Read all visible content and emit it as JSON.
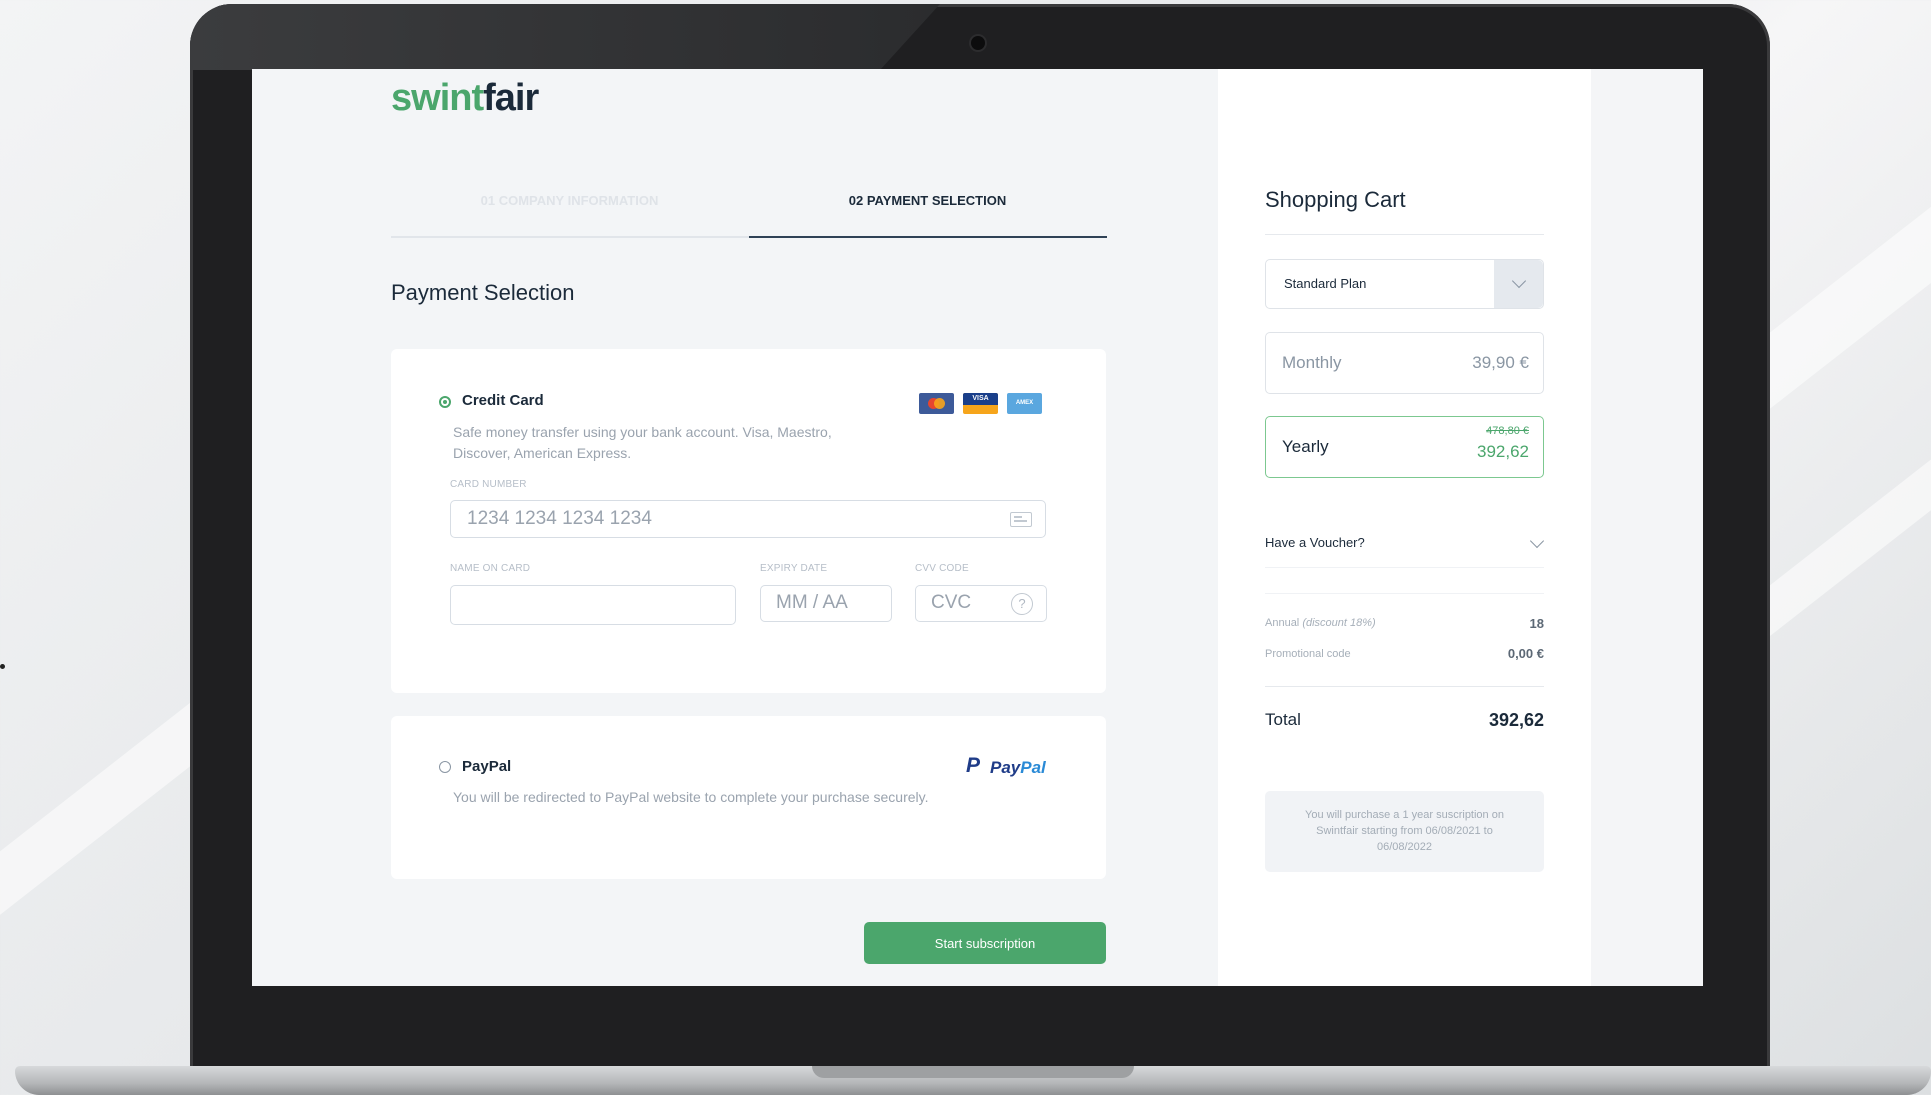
{
  "logo": {
    "part1": "swint",
    "part2": "fair"
  },
  "steps": [
    {
      "label": "01 COMPANY INFORMATION"
    },
    {
      "label": "02 PAYMENT SELECTION"
    }
  ],
  "payment": {
    "title": "Payment Selection",
    "credit_card": {
      "title": "Credit Card",
      "description": "Safe money transfer using your bank account. Visa, Maestro, Discover, American Express.",
      "brands": [
        "mastercard-icon",
        "visa-icon",
        "amex-icon"
      ],
      "visa_text": "VISA",
      "amex_text": "AMEX",
      "card_number_label": "CARD NUMBER",
      "card_number_placeholder": "1234 1234 1234 1234",
      "name_label": "NAME ON CARD",
      "name_value": "",
      "expiry_label": "EXPIRY DATE",
      "expiry_placeholder": "MM / AA",
      "cvv_label": "CVV CODE",
      "cvv_placeholder": "CVC",
      "help_glyph": "?"
    },
    "paypal": {
      "title": "PayPal",
      "description": "You will be redirected to PayPal website to complete your purchase securely.",
      "logo_p": "P",
      "logo_text1": "Pay",
      "logo_text2": "Pal"
    },
    "submit_label": "Start subscription"
  },
  "cart": {
    "title": "Shopping Cart",
    "plan_select": "Standard Plan",
    "monthly": {
      "label": "Monthly",
      "price": "39,90 €"
    },
    "yearly": {
      "label": "Yearly",
      "old_price": "478,80 €",
      "price": "392,62"
    },
    "voucher_label": "Have a Voucher?",
    "summary": {
      "annual_label": "Annual",
      "annual_discount": "(discount 18%)",
      "annual_value": "18",
      "promo_label": "Promotional code",
      "promo_value": "0,00 €"
    },
    "total_label": "Total",
    "total_value": "392,62",
    "note": "You will purchase a 1 year suscription on Swintfair starting from 06/08/2021 to 06/08/2022"
  },
  "colors": {
    "brand_green": "#4ba66c",
    "navy": "#1b2a3a",
    "muted": "#9aa3ae"
  }
}
